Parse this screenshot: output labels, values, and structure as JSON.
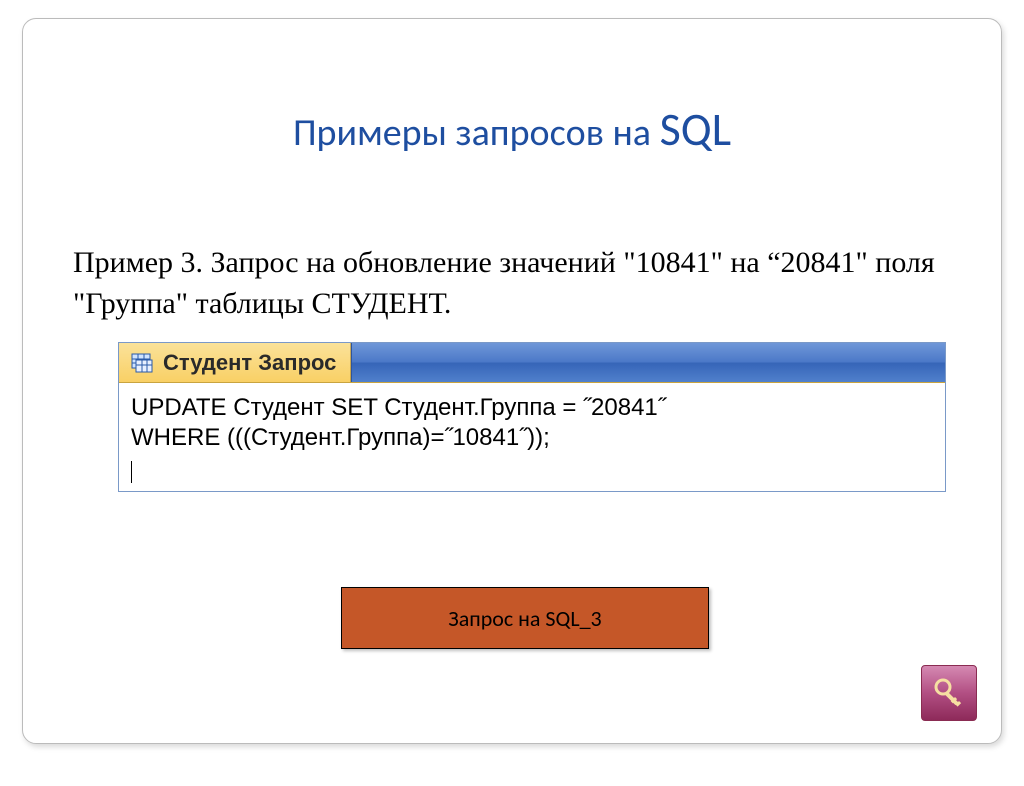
{
  "title_prefix": "Примеры запросов на ",
  "title_sql": "SQL",
  "body_text": "Пример 3.  Запрос на обновление значений \"10841\" на “20841\" поля \"Группа\" таблицы СТУДЕНТ.",
  "access": {
    "tab_label": "Студент Запрос",
    "sql_line1": "UPDATE Студент SET Студент.Группа = ˝20841˝",
    "sql_line2": "WHERE (((Студент.Группа)=˝10841˝));"
  },
  "button_label": "Запрос на SQL_3",
  "icons": {
    "access_tab": "query-grid-icon",
    "corner": "access-key-icon"
  }
}
